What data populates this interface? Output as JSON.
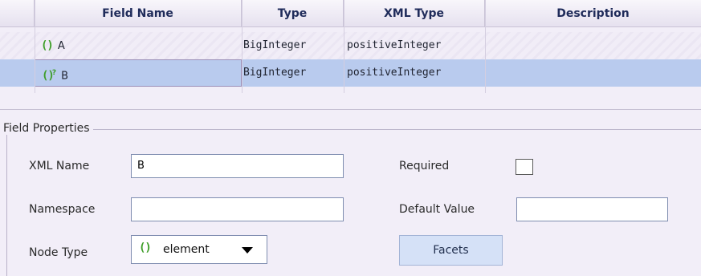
{
  "grid": {
    "columns": [
      "Field Name",
      "Type",
      "XML Type",
      "Description"
    ],
    "rows": [
      {
        "name": "A",
        "name_icon": "braces-icon",
        "type": "BigInteger",
        "xml_type": "positiveInteger",
        "description": "",
        "selected": false
      },
      {
        "name": "B",
        "name_icon": "braces-optional-icon",
        "name_icon_sup": "?",
        "type": "BigInteger",
        "xml_type": "positiveInteger",
        "description": "",
        "selected": true
      }
    ]
  },
  "field_properties": {
    "legend": "Field Properties",
    "xml_name_label": "XML Name",
    "xml_name_value": "B",
    "namespace_label": "Namespace",
    "namespace_value": "",
    "node_type_label": "Node Type",
    "node_type_value": "element",
    "required_label": "Required",
    "required_checked": false,
    "default_value_label": "Default Value",
    "default_value_value": "",
    "facets_label": "Facets"
  },
  "icons": {
    "braces": "()",
    "accent_green": "#3f9e2a",
    "selection_blue": "#b9cbee"
  }
}
